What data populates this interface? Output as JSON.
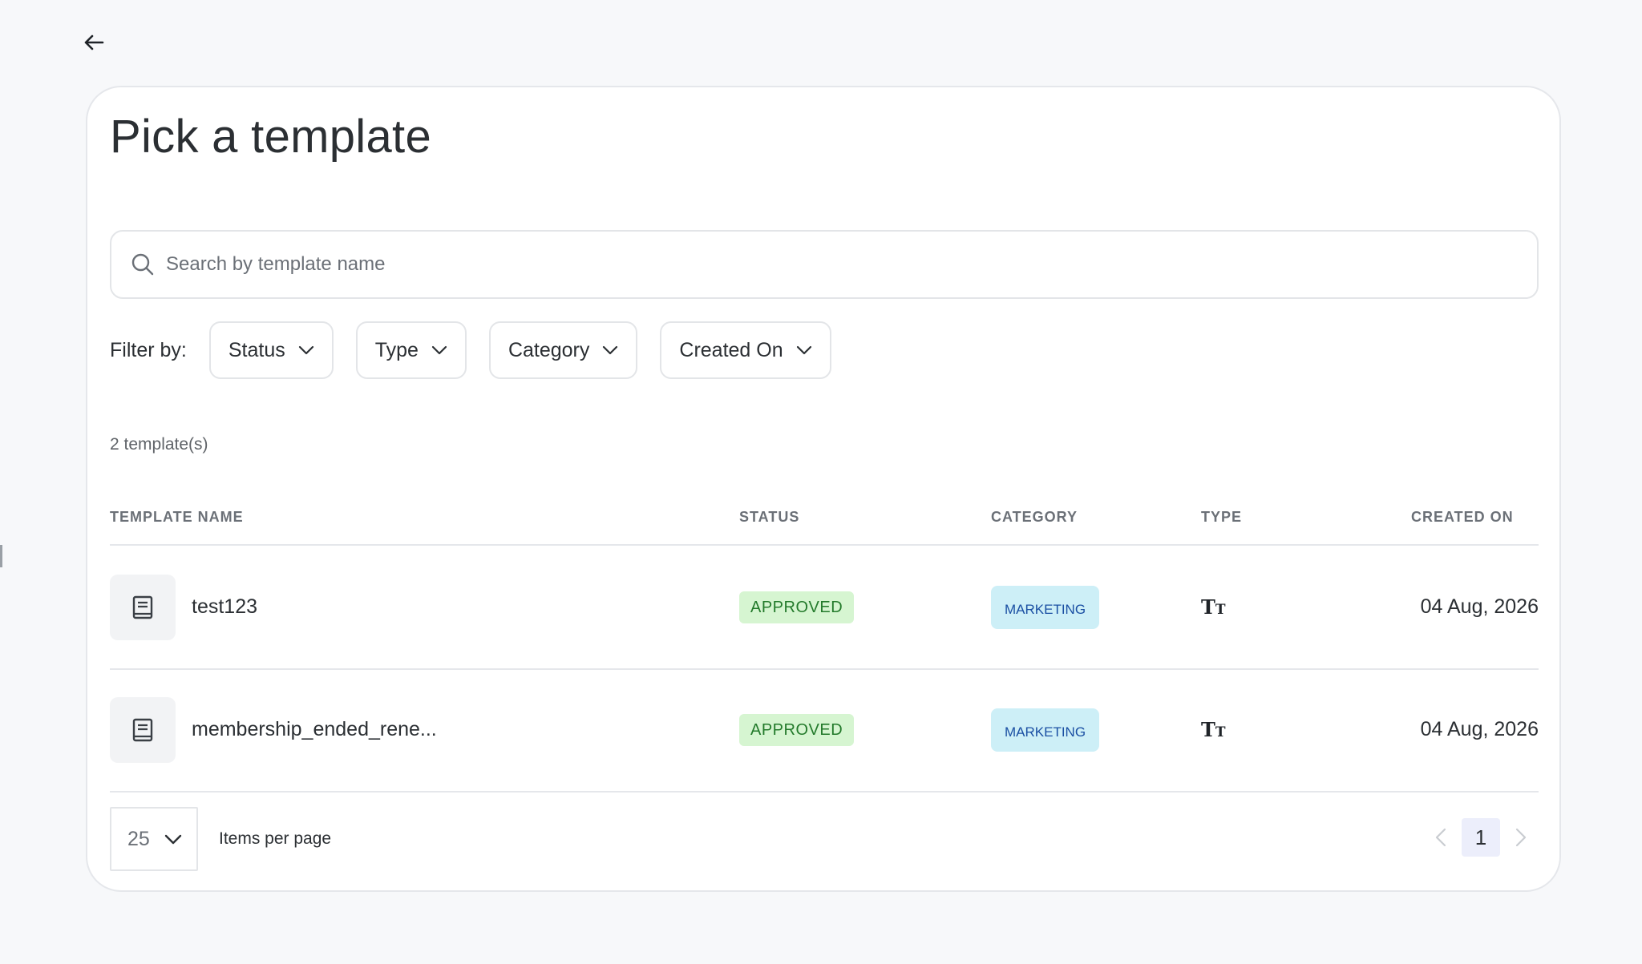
{
  "header": {
    "back_icon": "arrow-left-icon"
  },
  "page": {
    "title": "Pick a template"
  },
  "search": {
    "placeholder": "Search by template name",
    "value": "",
    "icon": "search-icon"
  },
  "filters": {
    "label": "Filter by:",
    "items": [
      {
        "label": "Status"
      },
      {
        "label": "Type"
      },
      {
        "label": "Category"
      },
      {
        "label": "Created On"
      }
    ]
  },
  "summary": {
    "count_text": "2 template(s)"
  },
  "table": {
    "columns": [
      "TEMPLATE NAME",
      "STATUS",
      "CATEGORY",
      "TYPE",
      "CREATED ON"
    ],
    "rows": [
      {
        "name": "test123",
        "status": "APPROVED",
        "category": "MARKETING",
        "type_icon": "text-type-icon",
        "type_glyph": "T",
        "type_glyph_small": "T",
        "created_on": "04 Aug, 2026"
      },
      {
        "name": "membership_ended_rene...",
        "status": "APPROVED",
        "category": "MARKETING",
        "type_icon": "text-type-icon",
        "type_glyph": "T",
        "type_glyph_small": "T",
        "created_on": "04 Aug, 2026"
      }
    ]
  },
  "pagination": {
    "per_page_value": "25",
    "per_page_label": "Items per page",
    "current_page": "1"
  },
  "colors": {
    "status_badge_bg": "#d6f5d1",
    "status_badge_text": "#237a2b",
    "category_badge_bg": "#cdeff7",
    "category_badge_text": "#1a4fa3",
    "active_page_bg": "#eceefb"
  }
}
